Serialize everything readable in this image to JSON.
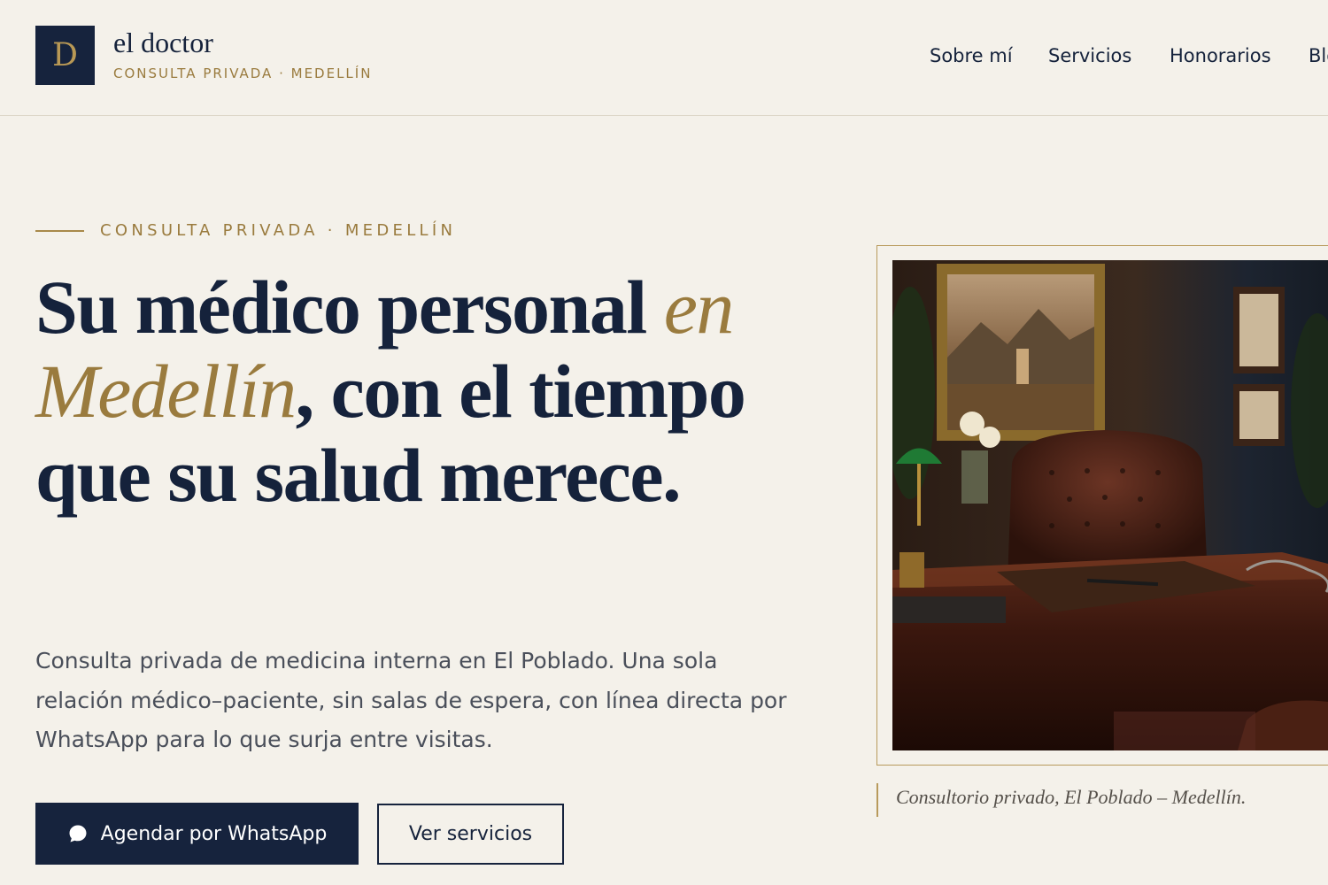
{
  "brand": {
    "logo_letter": "D",
    "name": "el doctor",
    "tagline": "CONSULTA PRIVADA · MEDELLÍN"
  },
  "nav": {
    "items": [
      {
        "label": "Sobre mí"
      },
      {
        "label": "Servicios"
      },
      {
        "label": "Honorarios"
      },
      {
        "label": "Blog"
      }
    ]
  },
  "hero": {
    "eyebrow": "CONSULTA PRIVADA · MEDELLÍN",
    "headline": {
      "part1": "Su médico personal ",
      "accent": "en Medellín",
      "part2": ", con el tiempo que su salud merece."
    },
    "lead": "Consulta privada de medicina interna en El Poblado. Una sola relación médico–paciente, sin salas de espera, con línea directa por WhatsApp para lo que surja entre visitas.",
    "primary_cta": {
      "label": "Agendar por WhatsApp",
      "icon": "chat-bubble-icon"
    },
    "secondary_cta": {
      "label": "Ver servicios"
    },
    "image_caption": "Consultorio privado, El Poblado – Medellín."
  },
  "colors": {
    "background": "#f4f1ea",
    "navy": "#16233d",
    "gold": "#9a7b3e",
    "body_text": "#4a4f5a"
  }
}
